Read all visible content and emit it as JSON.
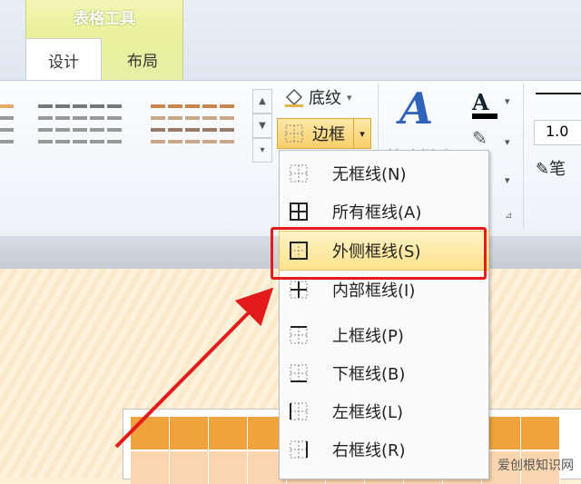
{
  "ribbon": {
    "context_group_title": "表格工具",
    "tabs": [
      {
        "label": "设计",
        "active": true
      },
      {
        "label": "布局",
        "active": false
      }
    ],
    "shading_label": "底纹",
    "border_label": "边框",
    "partial_label_1": "快速样式",
    "partial_label_2": "笔",
    "partial_value": "1.0"
  },
  "menu": {
    "items": [
      {
        "label": "无框线(N)",
        "icon": "no-border-icon"
      },
      {
        "label": "所有框线(A)",
        "icon": "all-borders-icon"
      },
      {
        "label": "外侧框线(S)",
        "icon": "outside-borders-icon",
        "highlighted": true
      },
      {
        "label": "内部框线(I)",
        "icon": "inside-borders-icon"
      },
      {
        "label": "上框线(P)",
        "icon": "top-border-icon"
      },
      {
        "label": "下框线(B)",
        "icon": "bottom-border-icon"
      },
      {
        "label": "左框线(L)",
        "icon": "left-border-icon"
      },
      {
        "label": "右框线(R)",
        "icon": "right-border-icon"
      }
    ]
  },
  "watermark": "爱创根知识网",
  "colors": {
    "annotation": "#e31b1b",
    "highlight": "#fde28c",
    "table_header": "#f0a23c"
  }
}
